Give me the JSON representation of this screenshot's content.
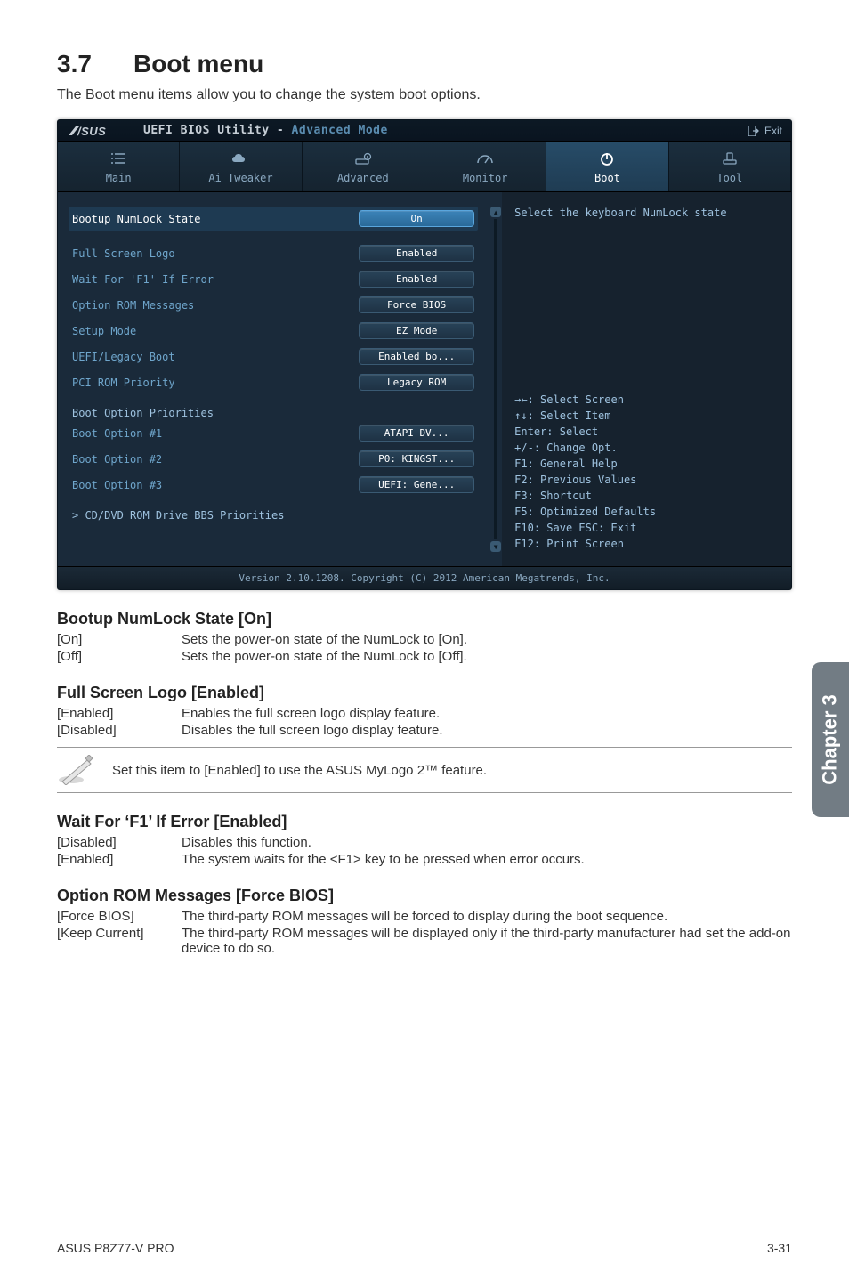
{
  "page": {
    "section_no": "3.7",
    "section_title": "Boot menu",
    "intro": "The Boot menu items allow you to change the system boot options.",
    "side_tab": "Chapter 3",
    "footer_left": "ASUS P8Z77-V PRO",
    "footer_right": "3-31"
  },
  "bios": {
    "titlebar": "UEFI BIOS Utility - Advanced Mode",
    "exit_label": "Exit",
    "tabs": [
      {
        "id": "main",
        "label": "Main"
      },
      {
        "id": "ai",
        "label": "Ai Tweaker"
      },
      {
        "id": "adv",
        "label": "Advanced"
      },
      {
        "id": "mon",
        "label": "Monitor"
      },
      {
        "id": "boot",
        "label": "Boot",
        "active": true
      },
      {
        "id": "tool",
        "label": "Tool"
      }
    ],
    "options": [
      {
        "label": "Bootup NumLock State",
        "value": "On",
        "selected": true
      },
      {
        "_gap": true
      },
      {
        "label": "Full Screen Logo",
        "value": "Enabled"
      },
      {
        "label": "Wait For 'F1' If Error",
        "value": "Enabled"
      },
      {
        "label": "Option ROM Messages",
        "value": "Force BIOS"
      },
      {
        "label": "Setup Mode",
        "value": "EZ Mode"
      },
      {
        "label": "UEFI/Legacy Boot",
        "value": "Enabled bo..."
      },
      {
        "label": "PCI ROM Priority",
        "value": "Legacy ROM"
      },
      {
        "_gap": true
      },
      {
        "label": "Boot Option Priorities",
        "_head": true
      },
      {
        "label": "Boot Option #1",
        "value": "ATAPI   DV..."
      },
      {
        "label": "Boot Option #2",
        "value": "P0: KINGST..."
      },
      {
        "label": "Boot Option #3",
        "value": "UEFI: Gene..."
      },
      {
        "_gap": true
      },
      {
        "label": "> CD/DVD ROM Drive BBS Priorities",
        "_head": true
      }
    ],
    "help_top": "Select the keyboard NumLock state",
    "help_keys": [
      "→←: Select Screen",
      "↑↓: Select Item",
      "Enter: Select",
      "+/-: Change Opt.",
      "F1: General Help",
      "F2: Previous Values",
      "F3: Shortcut",
      "F5: Optimized Defaults",
      "F10: Save  ESC: Exit",
      "F12: Print Screen"
    ],
    "footer": "Version 2.10.1208. Copyright (C) 2012 American Megatrends, Inc."
  },
  "sections": [
    {
      "title": "Bootup NumLock State [On]",
      "items": [
        {
          "k": "[On]",
          "v": "Sets the power-on state of the NumLock to [On]."
        },
        {
          "k": "[Off]",
          "v": "Sets the power-on state of the NumLock to [Off]."
        }
      ]
    },
    {
      "title": "Full Screen Logo [Enabled]",
      "items": [
        {
          "k": "[Enabled]",
          "v": "Enables the full screen logo display feature."
        },
        {
          "k": "[Disabled]",
          "v": "Disables the full screen logo display feature."
        }
      ],
      "note": "Set this item to [Enabled] to use the ASUS MyLogo 2™ feature."
    },
    {
      "title": "Wait For ‘F1’ If Error [Enabled]",
      "items": [
        {
          "k": "[Disabled]",
          "v": "Disables this function."
        },
        {
          "k": "[Enabled]",
          "v": "The system waits for the <F1> key to be pressed when error occurs."
        }
      ]
    },
    {
      "title": "Option ROM Messages [Force BIOS]",
      "items": [
        {
          "k": "[Force BIOS]",
          "v": "The third-party ROM messages will be forced to display during the boot sequence."
        },
        {
          "k": "[Keep Current]",
          "v": "The third-party ROM messages will be displayed only if the third-party manufacturer had set the add-on device to do so."
        }
      ]
    }
  ]
}
